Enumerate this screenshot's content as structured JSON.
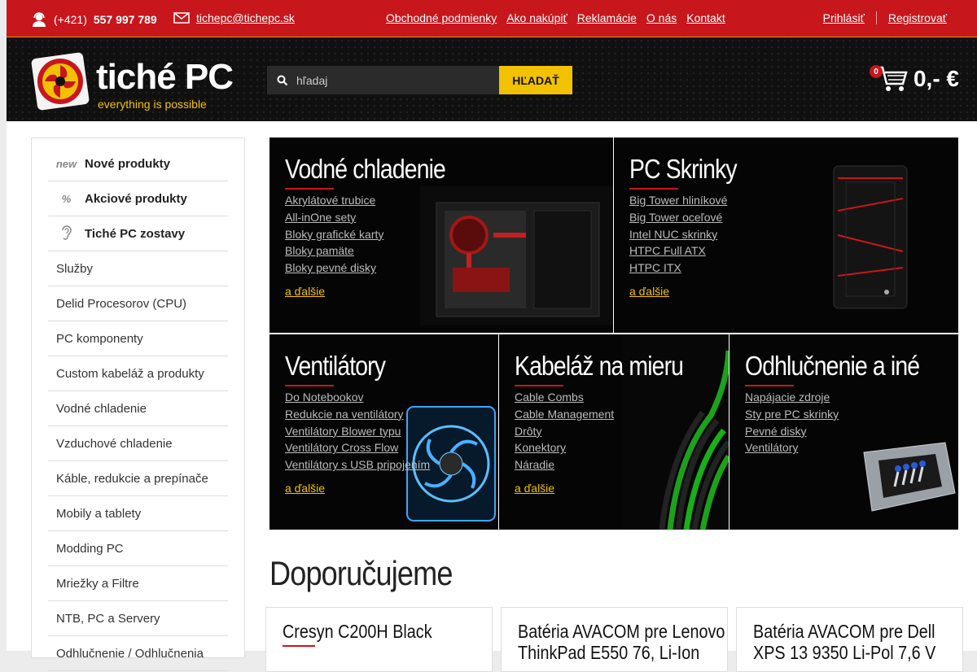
{
  "topbar": {
    "phone_prefix": "(+421)",
    "phone_number": "557 997 789",
    "email": "tichepc@tichepc.sk",
    "links": [
      "Obchodné podmienky",
      "Ako nakúpiť",
      "Reklamácie",
      "O nás",
      "Kontakt"
    ],
    "login": "Prihlásiť",
    "register": "Registrovať"
  },
  "header": {
    "logo_text": "tiché PC",
    "logo_tagline": "everything is possible",
    "search_placeholder": "hľadaj",
    "search_button": "HĽADAŤ",
    "cart_count": "0",
    "cart_amount": "0,- €"
  },
  "sidebar": {
    "special": [
      {
        "icon": "new",
        "label": "Nové produkty"
      },
      {
        "icon": "%",
        "label": "Akciové produkty"
      },
      {
        "icon": "ear",
        "label": "Tiché PC zostavy"
      }
    ],
    "items": [
      "Služby",
      "Delid Procesorov (CPU)",
      "PC komponenty",
      "Custom kabeláž a produkty",
      "Vodné chladenie",
      "Vzduchové chladenie",
      "Káble, redukcie a prepínače",
      "Mobily a tablety",
      "Modding PC",
      "Mriežky a Filtre",
      "NTB, PC a Servery",
      "Odhlučnenie / Odhlučnenia"
    ]
  },
  "categories": {
    "water": {
      "title": "Vodné chladenie",
      "links": [
        "Akrylátové trubice",
        "All-inOne sety",
        "Bloky grafické karty",
        "Bloky pamäte",
        "Bloky pevné disky"
      ],
      "more": "a ďalšie"
    },
    "cases": {
      "title": "PC Skrinky",
      "links": [
        "Big Tower hliníkové",
        "Big Tower oceľové",
        "Intel NUC skrinky",
        "HTPC Full ATX",
        "HTPC ITX"
      ],
      "more": "a ďalšie"
    },
    "fans": {
      "title": "Ventilátory",
      "links": [
        "Do Notebookov",
        "Redukcie na ventilátory",
        "Ventilátory Blower typu",
        "Ventilátory Cross Flow",
        "Ventilátory s USB pripojením"
      ],
      "more": "a ďalšie"
    },
    "cables": {
      "title": "Kabeláž na mieru",
      "links": [
        "Cable Combs",
        "Cable Management",
        "Drôty",
        "Konektory",
        "Náradie"
      ],
      "more": "a ďalšie"
    },
    "noise": {
      "title": "Odhlučnenie a iné",
      "links": [
        "Napájacie zdroje",
        "Sty pre PC skrinky",
        "Pevné disky",
        "Ventilátory"
      ]
    }
  },
  "recommend": {
    "title": "Doporučujeme",
    "products": [
      "Cresyn C200H Black",
      "Batéria AVACOM pre Lenovo ThinkPad E550 76, Li-Ion",
      "Batéria AVACOM pre Dell XPS 13 9350 Li-Pol 7,6 V"
    ]
  },
  "colors": {
    "brand_red": "#c8161d",
    "accent_yellow": "#f2c200",
    "dark": "#050505"
  }
}
